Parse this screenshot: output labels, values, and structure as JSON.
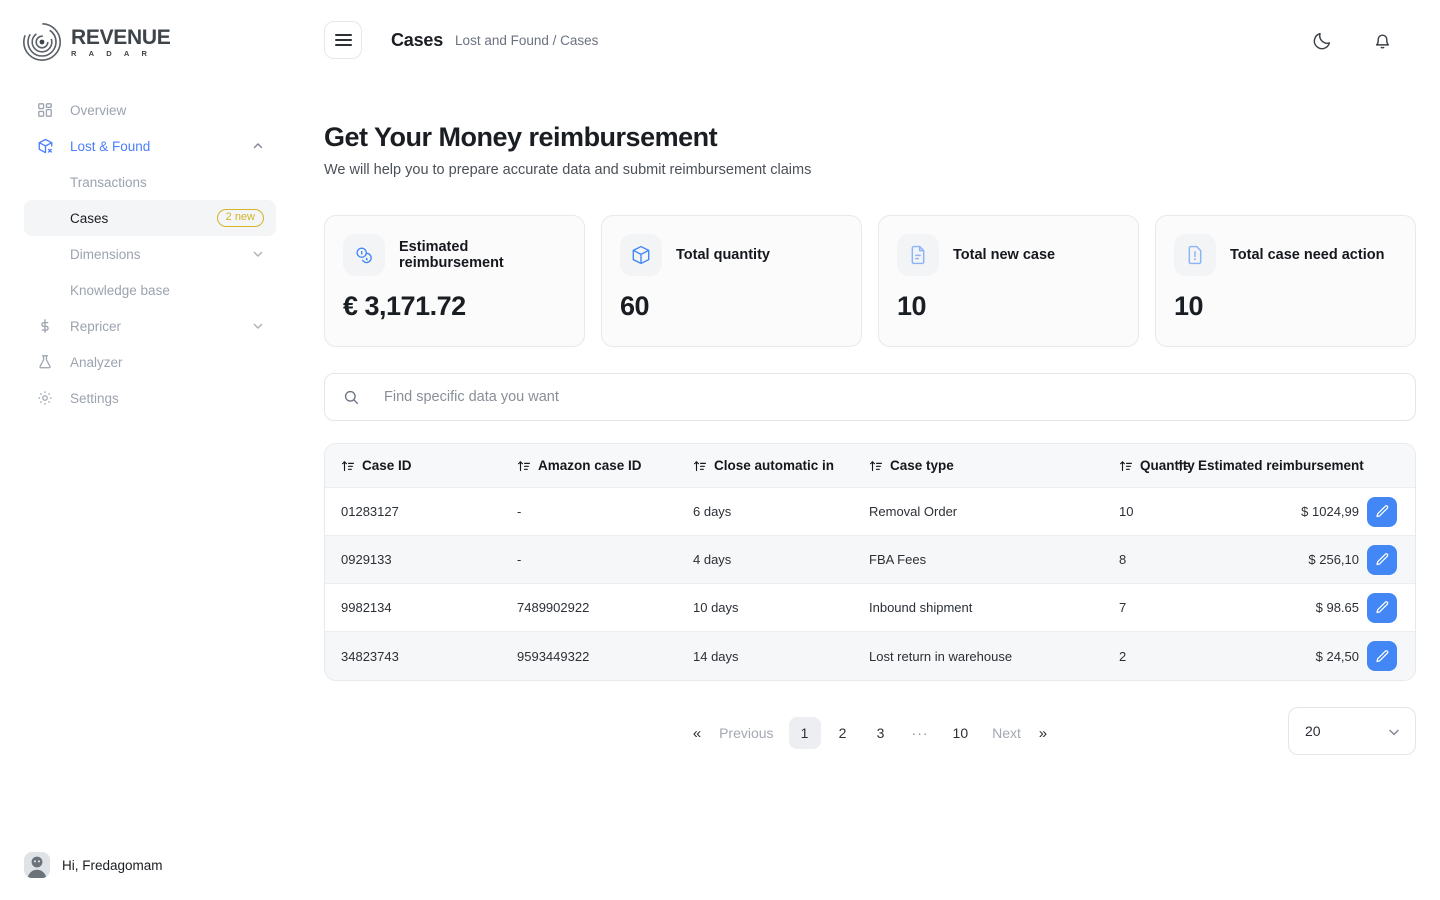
{
  "brand": {
    "name": "REVENUE",
    "tagline": "R A D A R",
    "logo_icon": "radar-spiral-icon"
  },
  "sidebar": {
    "items": [
      {
        "id": "overview",
        "label": "Overview",
        "icon": "grid-icon",
        "type": "top"
      },
      {
        "id": "lost-and-found",
        "label": "Lost & Found",
        "icon": "lost-box-icon",
        "type": "top",
        "active": true,
        "expanded": true,
        "chevron": "chevron-up-icon"
      },
      {
        "id": "transactions",
        "label": "Transactions",
        "type": "sub"
      },
      {
        "id": "cases",
        "label": "Cases",
        "type": "sub",
        "selected": true,
        "badge": "2 new"
      },
      {
        "id": "dimensions",
        "label": "Dimensions",
        "type": "sub",
        "chevron": "chevron-down-icon"
      },
      {
        "id": "knowledge-base",
        "label": "Knowledge base",
        "type": "sub"
      },
      {
        "id": "repricer",
        "label": "Repricer",
        "icon": "dollar-icon",
        "type": "top",
        "chevron": "chevron-down-icon"
      },
      {
        "id": "analyzer",
        "label": "Analyzer",
        "icon": "flask-icon",
        "type": "top",
        "chevron": "chevron-down-icon"
      },
      {
        "id": "settings",
        "label": "Settings",
        "icon": "gear-icon",
        "type": "top"
      }
    ],
    "user": {
      "greeting": "Hi, Fredagomam",
      "avatar": "user-avatar"
    }
  },
  "topbar": {
    "menu_icon": "hamburger-icon",
    "title": "Cases",
    "breadcrumb": "Lost and Found / Cases",
    "theme_icon": "moon-icon",
    "notifications_icon": "bell-icon"
  },
  "page": {
    "title": "Get Your Money reimbursement",
    "subtitle": "We will help you to prepare accurate data and submit reimbursement claims"
  },
  "stats": [
    {
      "label": "Estimated reimbursement",
      "value": "€ 3,171.72",
      "icon": "coins-icon"
    },
    {
      "label": "Total quantity",
      "value": "60",
      "icon": "box-icon"
    },
    {
      "label": "Total new case",
      "value": "10",
      "icon": "document-lines-icon"
    },
    {
      "label": "Total case need action",
      "value": "10",
      "icon": "document-alert-icon"
    }
  ],
  "search": {
    "placeholder": "Find specific data you want",
    "value": "",
    "icon": "search-icon"
  },
  "table": {
    "sort_icon": "sort-asc-icon",
    "columns": [
      {
        "key": "case_id",
        "label": "Case ID"
      },
      {
        "key": "amazon_id",
        "label": "Amazon case ID"
      },
      {
        "key": "close_in",
        "label": "Close automatic in"
      },
      {
        "key": "case_type",
        "label": "Case type"
      },
      {
        "key": "quantity",
        "label": "Quantity"
      },
      {
        "key": "reimbursement",
        "label": "Estimated reimbursement"
      }
    ],
    "rows": [
      {
        "case_id": "01283127",
        "amazon_id": "-",
        "close_in": "6 days",
        "case_type": "Removal Order",
        "quantity": "10",
        "reimbursement": "$ 1024,99",
        "action_icon": "edit-pencil-icon"
      },
      {
        "case_id": "0929133",
        "amazon_id": "-",
        "close_in": "4 days",
        "case_type": "FBA Fees",
        "quantity": "8",
        "reimbursement": "$ 256,10",
        "action_icon": "edit-pencil-icon"
      },
      {
        "case_id": "9982134",
        "amazon_id": "7489902922",
        "close_in": "10 days",
        "case_type": "Inbound shipment",
        "quantity": "7",
        "reimbursement": "$ 98.65",
        "action_icon": "edit-pencil-icon"
      },
      {
        "case_id": "34823743",
        "amazon_id": "9593449322",
        "close_in": "14 days",
        "case_type": "Lost return in warehouse",
        "quantity": "2",
        "reimbursement": "$ 24,50",
        "action_icon": "edit-pencil-icon"
      }
    ]
  },
  "pagination": {
    "first_glyph": "«",
    "previous_label": "Previous",
    "pages": [
      "1",
      "2",
      "3",
      "···",
      "10"
    ],
    "active_page": "1",
    "next_label": "Next",
    "last_glyph": "»",
    "page_size": "20",
    "page_size_chevron": "chevron-down-icon"
  },
  "colors": {
    "accent_blue": "#4287f5",
    "nav_active": "#4a7dff",
    "badge_gold": "#d4b429",
    "text_dark": "#15181c",
    "text_muted": "#9ca3af"
  }
}
